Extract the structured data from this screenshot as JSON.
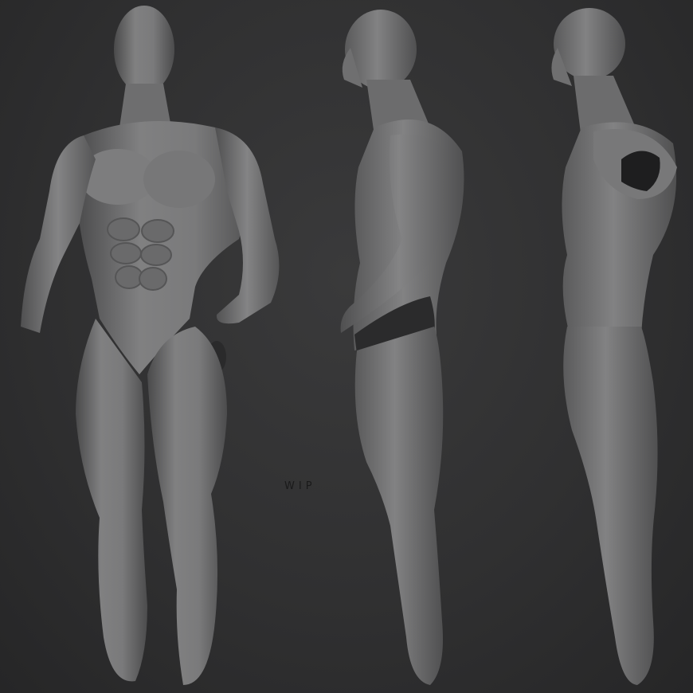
{
  "image": {
    "subject": "3d-sculpt-male-anatomy",
    "views": [
      "front-three-quarter",
      "side",
      "side-back"
    ],
    "background_color": "#2f2f30",
    "clay_color": "#7a7a7b",
    "shadow_color": "#3f3f40",
    "label": "WIP"
  }
}
